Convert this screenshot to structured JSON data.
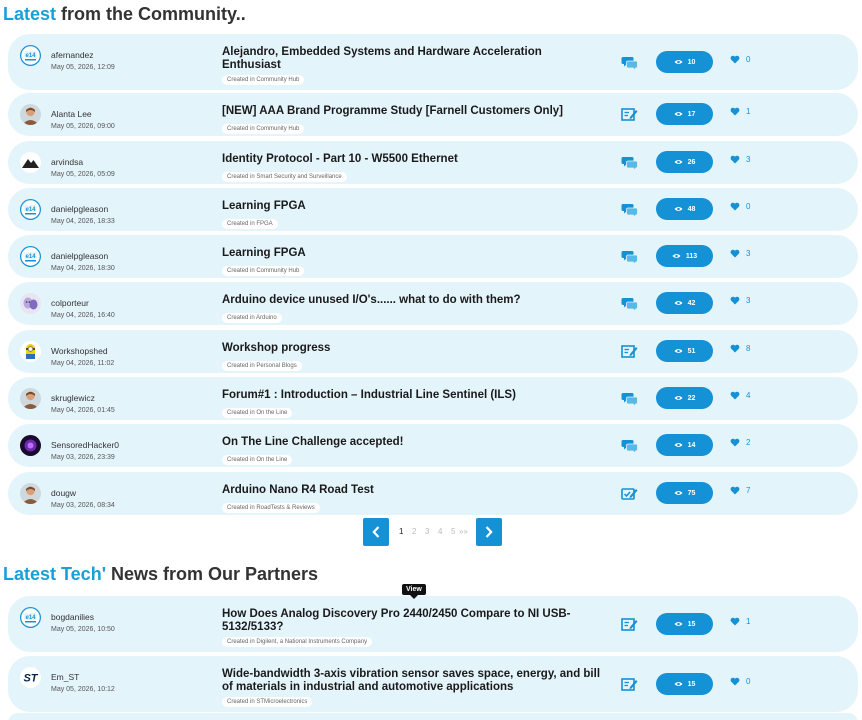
{
  "community": {
    "title_accent": "Latest",
    "title_rest": "from the Community..",
    "posts": [
      {
        "user": "afernandez",
        "date": "May 05, 2026, 12:09",
        "title": "Alejandro, Embedded Systems and Hardware Acceleration Enthusiast",
        "category": "Created in Community Hub",
        "views": "10",
        "likes": "0",
        "type_icon": "discussion-icon",
        "avatar_icon": "e14-logo-avatar"
      },
      {
        "user": "Alanta Lee",
        "date": "May 05, 2026, 09:00",
        "title": "[NEW] AAA Brand Programme Study [Farnell Customers Only]",
        "category": "Created in Community Hub",
        "views": "17",
        "likes": "1",
        "type_icon": "blog-icon",
        "avatar_icon": "person-avatar"
      },
      {
        "user": "arvindsa",
        "date": "May 05, 2026, 05:09",
        "title": "Identity Protocol - Part 10 - W5500 Ethernet",
        "category": "Created in Smart Security and Surveillance",
        "views": "26",
        "likes": "3",
        "type_icon": "discussion-icon",
        "avatar_icon": "mountain-avatar"
      },
      {
        "user": "danielpgleason",
        "date": "May 04, 2026, 18:33",
        "title": "Learning FPGA",
        "category": "Created in FPGA",
        "views": "48",
        "likes": "0",
        "type_icon": "discussion-icon",
        "avatar_icon": "e14-logo-avatar"
      },
      {
        "user": "danielpgleason",
        "date": "May 04, 2026, 18:30",
        "title": "Learning FPGA",
        "category": "Created in Community Hub",
        "views": "113",
        "likes": "3",
        "type_icon": "discussion-icon",
        "avatar_icon": "e14-logo-avatar"
      },
      {
        "user": "colporteur",
        "date": "May 04, 2026, 16:40",
        "title": "Arduino device unused I/O's...... what to do with them?",
        "category": "Created in Arduino",
        "views": "42",
        "likes": "3",
        "type_icon": "discussion-icon",
        "avatar_icon": "masks-avatar"
      },
      {
        "user": "Workshopshed",
        "date": "May 04, 2026, 11:02",
        "title": "Workshop progress",
        "category": "Created in Personal Blogs",
        "views": "51",
        "likes": "8",
        "type_icon": "blog-icon",
        "avatar_icon": "minion-avatar"
      },
      {
        "user": "skruglewicz",
        "date": "May 04, 2026, 01:45",
        "title": "Forum#1 : Introduction – Industrial Line Sentinel (ILS)",
        "category": "Created in On the Line",
        "views": "22",
        "likes": "4",
        "type_icon": "discussion-icon",
        "avatar_icon": "person-avatar"
      },
      {
        "user": "SensoredHacker0",
        "date": "May 03, 2026, 23:39",
        "title": "On The Line Challenge accepted!",
        "category": "Created in On the Line",
        "views": "14",
        "likes": "2",
        "type_icon": "discussion-icon",
        "avatar_icon": "purple-avatar"
      },
      {
        "user": "dougw",
        "date": "May 03, 2026, 08:34",
        "title": "Arduino Nano R4 Road Test",
        "category": "Created in RoadTests & Reviews",
        "views": "75",
        "likes": "7",
        "type_icon": "roadtest-icon",
        "avatar_icon": "person-avatar"
      }
    ]
  },
  "pagination": {
    "pages": [
      "1",
      "2",
      "3",
      "4",
      "5"
    ],
    "active": "1",
    "more": "»»"
  },
  "tooltip": "View",
  "partners": {
    "title_accent": "Latest Tech'",
    "title_rest": "News from Our Partners",
    "posts": [
      {
        "user": "bogdanilies",
        "date": "May 05, 2026, 10:50",
        "title": "How Does Analog Discovery Pro 2440/2450 Compare to NI USB-5132/5133?",
        "category": "Created in Digilent, a National Instruments Company",
        "views": "15",
        "likes": "1",
        "type_icon": "blog-icon",
        "avatar_icon": "e14-logo-avatar"
      },
      {
        "user": "Em_ST",
        "date": "May 05, 2026, 10:12",
        "title": "Wide-bandwidth 3-axis vibration sensor saves space, energy, and bill of materials in industrial and automotive applications",
        "category": "Created in STMicroelectronics",
        "views": "15",
        "likes": "0",
        "type_icon": "blog-icon",
        "avatar_icon": "st-logo-avatar"
      }
    ]
  },
  "colors": {
    "accent": "#1a9fd6",
    "button": "#1591d6",
    "row_bg": "#e4f4fb"
  }
}
